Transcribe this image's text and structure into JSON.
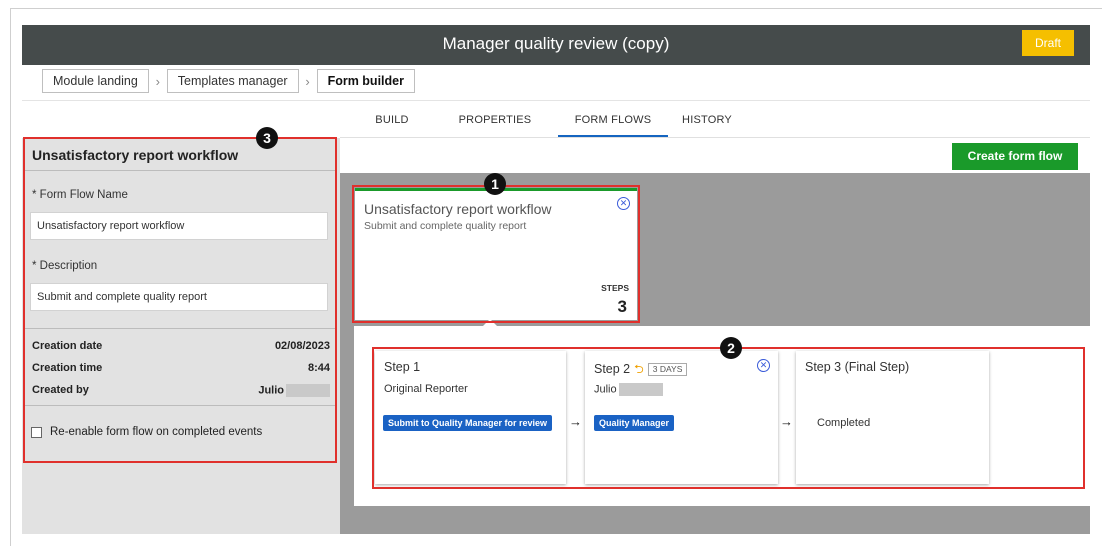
{
  "header": {
    "title": "Manager quality review (copy)",
    "status_badge": "Draft"
  },
  "breadcrumb": [
    "Module landing",
    "Templates manager",
    "Form builder"
  ],
  "tabs": [
    "BUILD",
    "PROPERTIES",
    "FORM FLOWS",
    "HISTORY"
  ],
  "active_tab": "FORM FLOWS",
  "left_panel": {
    "title": "Unsatisfactory report workflow",
    "name_label": "* Form Flow Name",
    "name_value": "Unsatisfactory report workflow",
    "description_label": "* Description",
    "description_value": "Submit and complete quality report",
    "creation_date_label": "Creation date",
    "creation_date": "02/08/2023",
    "creation_time_label": "Creation time",
    "creation_time": "8:44",
    "created_by_label": "Created by",
    "created_by": "Julio",
    "reenable_label": "Re-enable form flow on completed events",
    "reenable_checked": false
  },
  "toolbar": {
    "create_label": "Create form flow"
  },
  "flow_card": {
    "title": "Unsatisfactory report workflow",
    "subtitle": "Submit and complete quality report",
    "steps_label": "STEPS",
    "steps_count": "3"
  },
  "steps": [
    {
      "title": "Step 1",
      "person": "Original Reporter",
      "action": "Submit to Quality Manager for review"
    },
    {
      "title": "Step 2",
      "days": "3 DAYS",
      "person": "Julio",
      "action": "Quality Manager"
    },
    {
      "title": "Step 3 (Final Step)",
      "status": "Completed"
    }
  ],
  "annotations": [
    "1",
    "2",
    "3"
  ],
  "colors": {
    "header_bg": "#454b4b",
    "draft": "#f5bf00",
    "accent_green": "#1a9a2a",
    "tag_blue": "#1a62c4",
    "highlight": "#e0302c"
  },
  "icons": {
    "close": "circle-x-icon",
    "revert": "undo-arrow-icon",
    "arrow": "right-arrow-icon"
  }
}
